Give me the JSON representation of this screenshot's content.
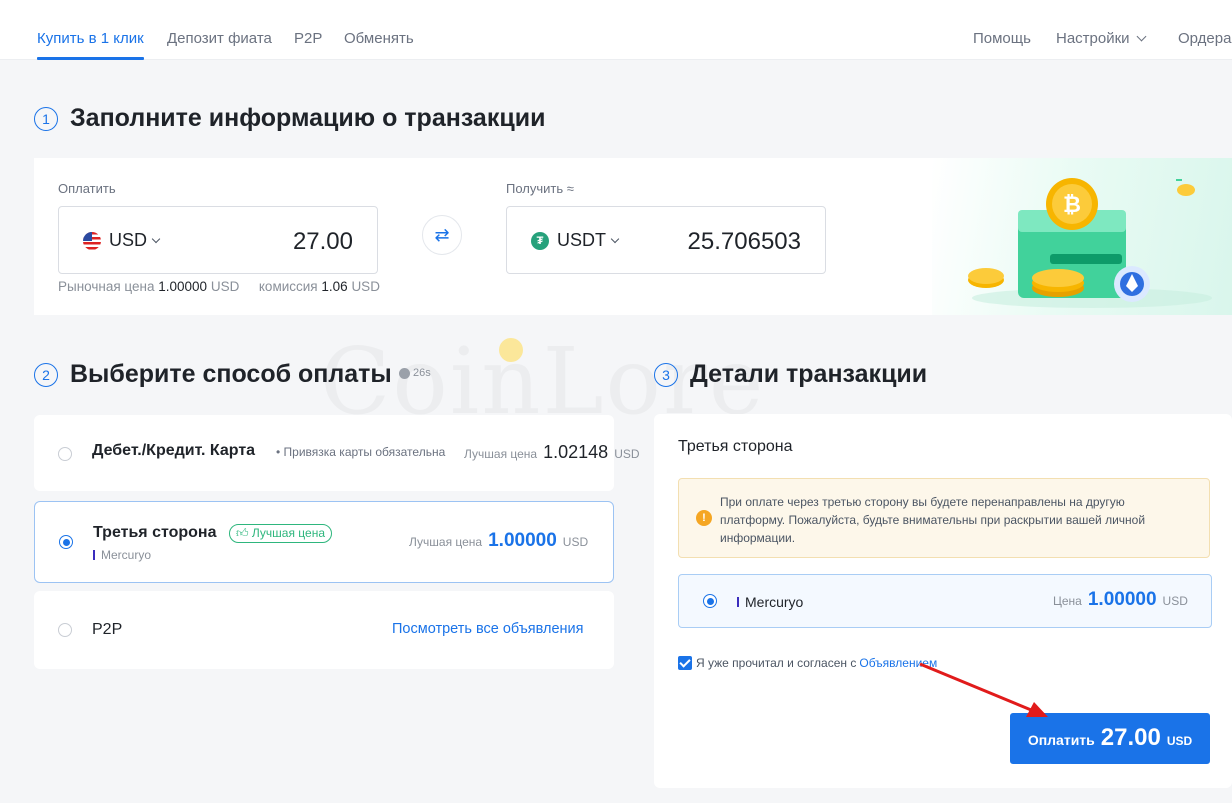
{
  "nav": {
    "tabs": [
      "Купить в 1 клик",
      "Депозит фиата",
      "P2P",
      "Обменять"
    ],
    "right": [
      "Помощь",
      "Настройки",
      "Ордера"
    ]
  },
  "section1": {
    "number": "1",
    "title": "Заполните информацию о транзакции",
    "pay_label": "Оплатить",
    "receive_label": "Получить ≈",
    "pay_currency": "USD",
    "pay_amount": "27.00",
    "receive_currency": "USDT",
    "receive_amount": "25.706503",
    "market_label": "Рыночная цена",
    "market_value": "1.00000",
    "market_unit": "USD",
    "fee_label": "комиссия",
    "fee_value": "1.06",
    "fee_unit": "USD"
  },
  "section2": {
    "number": "2",
    "title": "Выберите способ оплаты",
    "timer": "26s",
    "methods": [
      {
        "name": "Дебет./Кредит. Карта",
        "sub": "Привязка карты обязательна",
        "price_label": "Лучшая цена",
        "price": "1.02148",
        "unit": "USD"
      },
      {
        "name": "Третья сторона",
        "badge": "Лучшая цена",
        "provider": "Mercuryo",
        "price_label": "Лучшая цена",
        "price": "1.00000",
        "unit": "USD"
      },
      {
        "name": "P2P",
        "link": "Посмотреть все объявления"
      }
    ]
  },
  "section3": {
    "number": "3",
    "title": "Детали транзакции",
    "subtitle": "Третья сторона",
    "warning": "При оплате через третью сторону вы будете перенаправлены на другую платформу. Пожалуйста, будьте внимательны при раскрытии вашей личной информации.",
    "provider": "Mercuryo",
    "price_label": "Цена",
    "price": "1.00000",
    "unit": "USD",
    "agree_text": "Я уже прочитал и согласен с",
    "agree_link": "Объявлением",
    "pay_button": {
      "label": "Оплатить",
      "amount": "27.00",
      "unit": "USD"
    }
  },
  "watermark": "CoinLore",
  "colors": {
    "accent": "#1a73e8",
    "success": "#2eb67d",
    "warning": "#f5a623"
  }
}
